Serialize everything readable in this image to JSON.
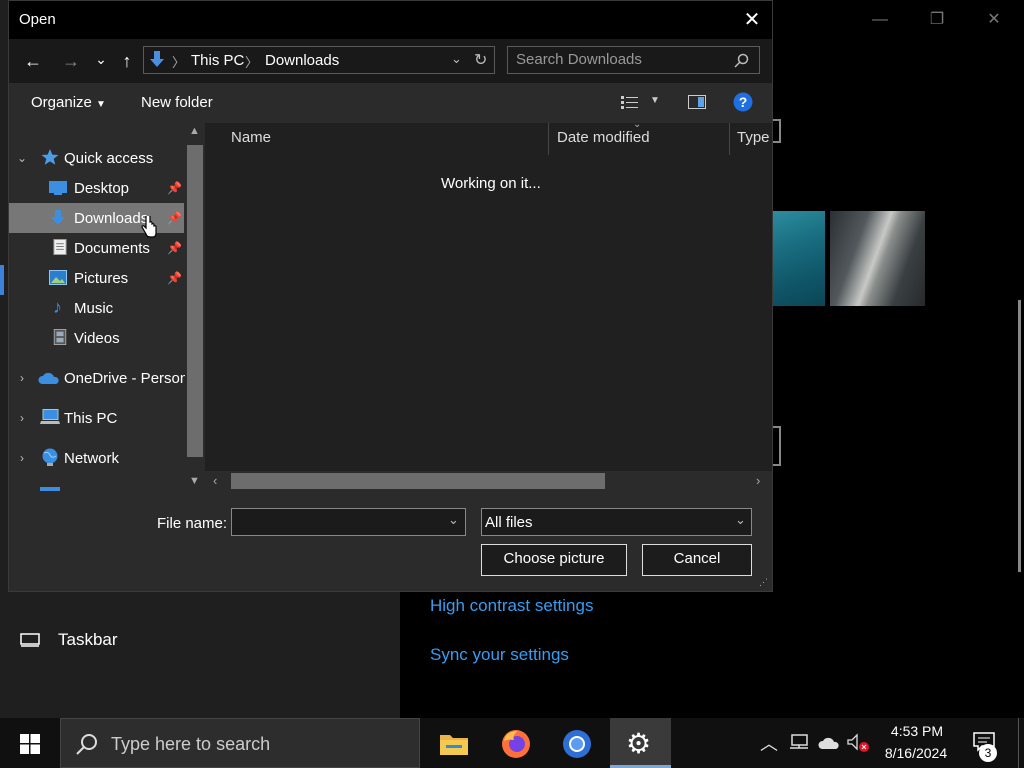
{
  "dialog": {
    "title": "Open",
    "close_glyph": "✕",
    "nav": {
      "back_glyph": "←",
      "forward_glyph": "→",
      "recent_glyph": "⌄",
      "up_glyph": "↑"
    },
    "breadcrumb": [
      "This PC",
      "Downloads"
    ],
    "search_placeholder": "Search Downloads",
    "toolbar": {
      "organize_label": "Organize",
      "new_folder_label": "New folder"
    },
    "nav_pane": {
      "quick_access": "Quick access",
      "items": [
        {
          "label": "Desktop",
          "pinned": true
        },
        {
          "label": "Downloads",
          "pinned": true,
          "selected": true
        },
        {
          "label": "Documents",
          "pinned": true
        },
        {
          "label": "Pictures",
          "pinned": true
        },
        {
          "label": "Music",
          "pinned": false
        },
        {
          "label": "Videos",
          "pinned": false
        }
      ],
      "onedrive": "OneDrive - Person",
      "this_pc": "This PC",
      "network": "Network"
    },
    "columns": [
      "Name",
      "Date modified",
      "Type"
    ],
    "status_message": "Working on it...",
    "file_name_label": "File name:",
    "file_name_value": "",
    "file_type": "All files",
    "choose_button": "Choose picture",
    "cancel_button": "Cancel"
  },
  "background": {
    "links": [
      "High contrast settings",
      "Sync your settings"
    ],
    "taskbar_setting": "Taskbar"
  },
  "taskbar": {
    "search_placeholder": "Type here to search",
    "time": "4:53 PM",
    "date": "8/16/2024",
    "notification_count": "3"
  },
  "colors": {
    "accent": "#3a9cf0",
    "help": "#1f6fe0"
  }
}
